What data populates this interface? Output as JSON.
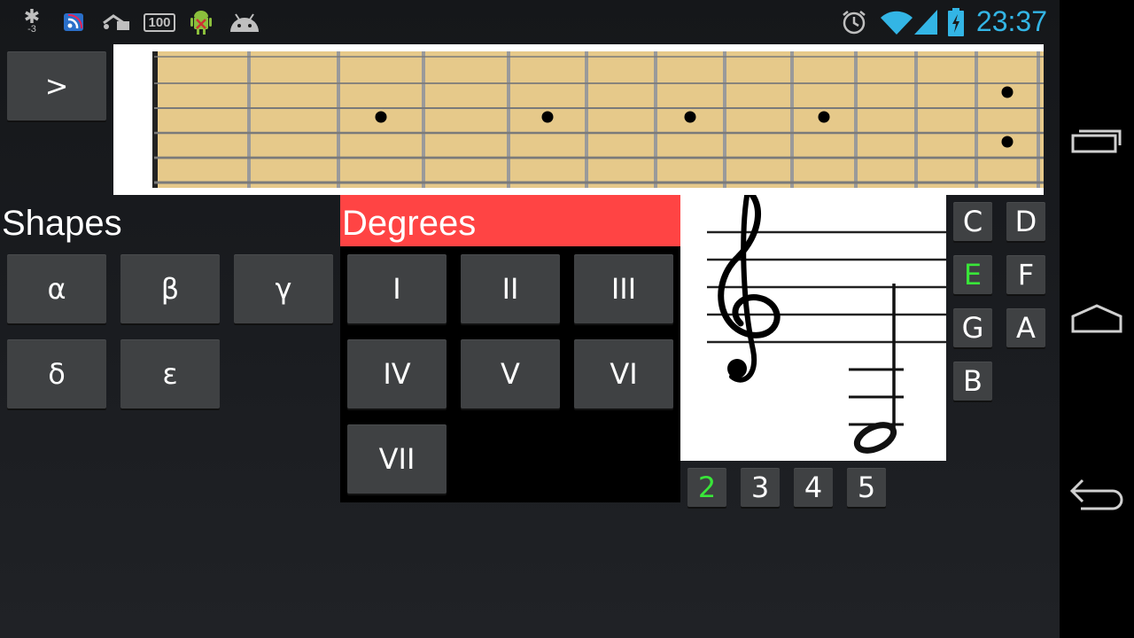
{
  "status_bar": {
    "signal_label": "-3",
    "battery_badge": "100",
    "clock": "23:37",
    "icons": [
      "bluetooth-icon",
      "rss-icon",
      "usb-icon",
      "battery-100-icon",
      "android-debug-icon",
      "android-head-icon",
      "alarm-icon",
      "wifi-icon",
      "cell-signal-icon",
      "battery-charging-icon"
    ]
  },
  "toggle": {
    "label": ">"
  },
  "fretboard": {
    "fret_count": 12,
    "string_count": 6,
    "inlay_frets": [
      3,
      5,
      7,
      9,
      12
    ],
    "wood_color": "#e6c98a"
  },
  "shapes": {
    "title": "Shapes",
    "buttons": [
      "α",
      "β",
      "γ",
      "δ",
      "ε"
    ]
  },
  "degrees": {
    "title": "Degrees",
    "header_color": "#ff4444",
    "buttons": [
      "I",
      "II",
      "III",
      "IV",
      "V",
      "VI",
      "VII"
    ]
  },
  "notes": {
    "buttons": [
      "C",
      "D",
      "E",
      "F",
      "G",
      "A",
      "B"
    ],
    "selected": "E"
  },
  "octaves": {
    "buttons": [
      "2",
      "3",
      "4",
      "5"
    ],
    "selected": "2"
  },
  "navbar": {
    "icons": [
      "recent-apps-icon",
      "home-icon",
      "back-icon"
    ]
  }
}
